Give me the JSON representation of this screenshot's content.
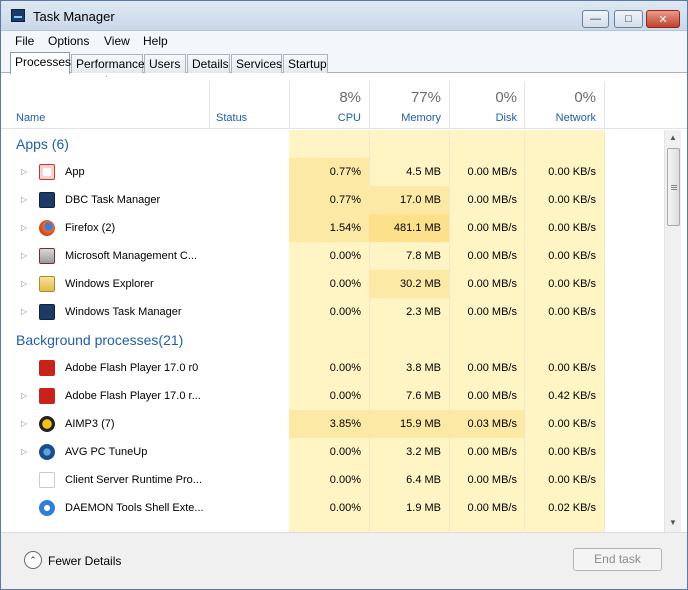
{
  "window": {
    "title": "Task Manager"
  },
  "menu": [
    "File",
    "Options",
    "View",
    "Help"
  ],
  "tabs": [
    "Processes",
    "Performance",
    "Users",
    "Details",
    "Services",
    "Startup"
  ],
  "header": {
    "name": "Name",
    "status": "Status",
    "cpu": {
      "pct": "8%",
      "label": "CPU"
    },
    "memory": {
      "pct": "77%",
      "label": "Memory"
    },
    "disk": {
      "pct": "0%",
      "label": "Disk"
    },
    "network": {
      "pct": "0%",
      "label": "Network"
    }
  },
  "groups": {
    "apps": "Apps (6)",
    "background": "Background processes(21)"
  },
  "apps": [
    {
      "name": "App",
      "icon": "app-icon",
      "cpu": "0.77%",
      "memory": "4.5 MB",
      "disk": "0.00 MB/s",
      "network": "0.00 KB/s"
    },
    {
      "name": "DBC Task Manager",
      "icon": "task-manager-icon",
      "cpu": "0.77%",
      "memory": "17.0 MB",
      "disk": "0.00 MB/s",
      "network": "0.00 KB/s"
    },
    {
      "name": "Firefox (2)",
      "icon": "firefox-icon",
      "cpu": "1.54%",
      "memory": "481.1 MB",
      "disk": "0.00 MB/s",
      "network": "0.00 KB/s"
    },
    {
      "name": "Microsoft Management C...",
      "icon": "management-console-icon",
      "cpu": "0.00%",
      "memory": "7.8 MB",
      "disk": "0.00 MB/s",
      "network": "0.00 KB/s"
    },
    {
      "name": "Windows Explorer",
      "icon": "folder-icon",
      "cpu": "0.00%",
      "memory": "30.2 MB",
      "disk": "0.00 MB/s",
      "network": "0.00 KB/s"
    },
    {
      "name": "Windows Task Manager",
      "icon": "task-manager-icon",
      "cpu": "0.00%",
      "memory": "2.3 MB",
      "disk": "0.00 MB/s",
      "network": "0.00 KB/s"
    }
  ],
  "background": [
    {
      "name": "Adobe Flash Player 17.0 r0",
      "icon": "flash-icon",
      "cpu": "0.00%",
      "memory": "3.8 MB",
      "disk": "0.00 MB/s",
      "network": "0.00 KB/s"
    },
    {
      "name": "Adobe Flash Player 17.0 r...",
      "icon": "flash-icon",
      "cpu": "0.00%",
      "memory": "7.6 MB",
      "disk": "0.00 MB/s",
      "network": "0.42 KB/s"
    },
    {
      "name": "AIMP3 (7)",
      "icon": "aimp-icon",
      "cpu": "3.85%",
      "memory": "15.9 MB",
      "disk": "0.03 MB/s",
      "network": "0.00 KB/s"
    },
    {
      "name": "AVG PC TuneUp",
      "icon": "avg-icon",
      "cpu": "0.00%",
      "memory": "3.2 MB",
      "disk": "0.00 MB/s",
      "network": "0.00 KB/s"
    },
    {
      "name": "Client Server Runtime Pro...",
      "icon": "blank-process-icon",
      "cpu": "0.00%",
      "memory": "6.4 MB",
      "disk": "0.00 MB/s",
      "network": "0.00 KB/s"
    },
    {
      "name": "DAEMON Tools Shell Exte...",
      "icon": "daemon-tools-icon",
      "cpu": "0.00%",
      "memory": "1.9 MB",
      "disk": "0.00 MB/s",
      "network": "0.02 KB/s"
    }
  ],
  "footer": {
    "fewer_details": "Fewer Details",
    "end_task": "End task"
  },
  "colors": {
    "accent": "#1f5fa6",
    "heat_low": "#fff4c4",
    "heat_med": "#fde9a6",
    "heat_high": "#fce08a"
  }
}
